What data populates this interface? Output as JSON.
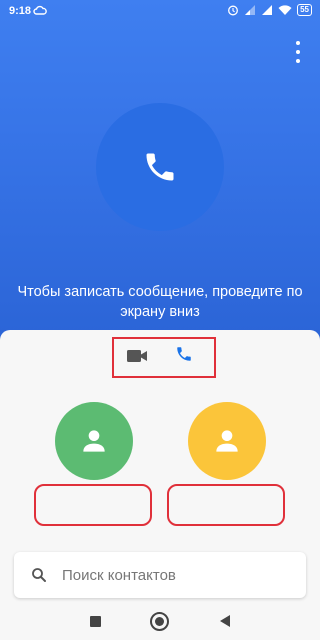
{
  "status_bar": {
    "time": "9:18",
    "battery": "55",
    "icons": [
      "cloud-icon",
      "alarm-icon",
      "signal-icon",
      "signal-icon",
      "wifi-icon",
      "battery-icon"
    ]
  },
  "call_screen": {
    "hint_text": "Чтобы записать сообщение, проведите по экрану вниз",
    "call_icon": "phone-icon"
  },
  "call_modes": {
    "video_icon": "video-call-icon",
    "voice_icon": "phone-icon"
  },
  "contacts": [
    {
      "avatar_color": "#5cbb72",
      "name": ""
    },
    {
      "avatar_color": "#fbc53a",
      "name": ""
    }
  ],
  "search": {
    "placeholder": "Поиск контактов",
    "value": ""
  },
  "nav_bar": {
    "icons": [
      "recent-apps-icon",
      "home-icon",
      "back-icon"
    ]
  },
  "colors": {
    "primary": "#3673e6",
    "accent_blue": "#1a73e8",
    "highlight_red": "#e0303a"
  }
}
